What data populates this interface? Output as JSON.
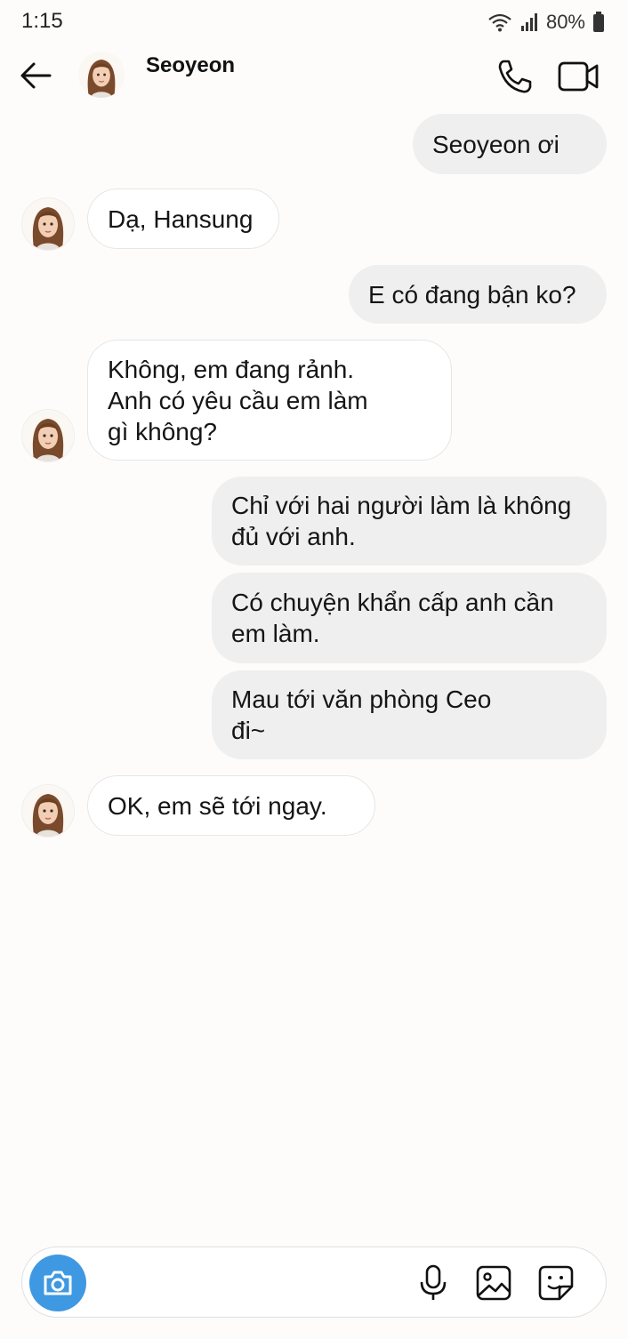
{
  "status_bar": {
    "time": "1:15",
    "battery": "80%"
  },
  "header": {
    "contact_name": "Seoyeon",
    "icons": [
      "back-arrow-icon",
      "phone-icon",
      "video-camera-icon"
    ]
  },
  "messages": [
    {
      "sender": "me",
      "text": "Seoyeon ơi"
    },
    {
      "sender": "Seoyeon",
      "text": "Dạ, Hansung"
    },
    {
      "sender": "me",
      "text": "E có đang bận ko?"
    },
    {
      "sender": "Seoyeon",
      "text": "Không, em đang rảnh.\nAnh có yêu cầu em làm\ngì không?"
    },
    {
      "sender": "me",
      "text": "Chỉ với hai người làm là không\nđủ với anh."
    },
    {
      "sender": "me",
      "text": "Có chuyện khẩn cấp anh cần\nem làm."
    },
    {
      "sender": "me",
      "text": "Mau tới văn phòng Ceo\nđi~"
    },
    {
      "sender": "Seoyeon",
      "text": "OK, em sẽ tới ngay."
    }
  ],
  "composer": {
    "placeholder": "",
    "icons": [
      "camera-icon",
      "microphone-icon",
      "gallery-icon",
      "sticker-icon"
    ]
  },
  "colors": {
    "background": "#fdfcfb",
    "sent_bubble": "#efefef",
    "received_bubble": "#ffffff",
    "camera_button": "#3e98e2"
  }
}
